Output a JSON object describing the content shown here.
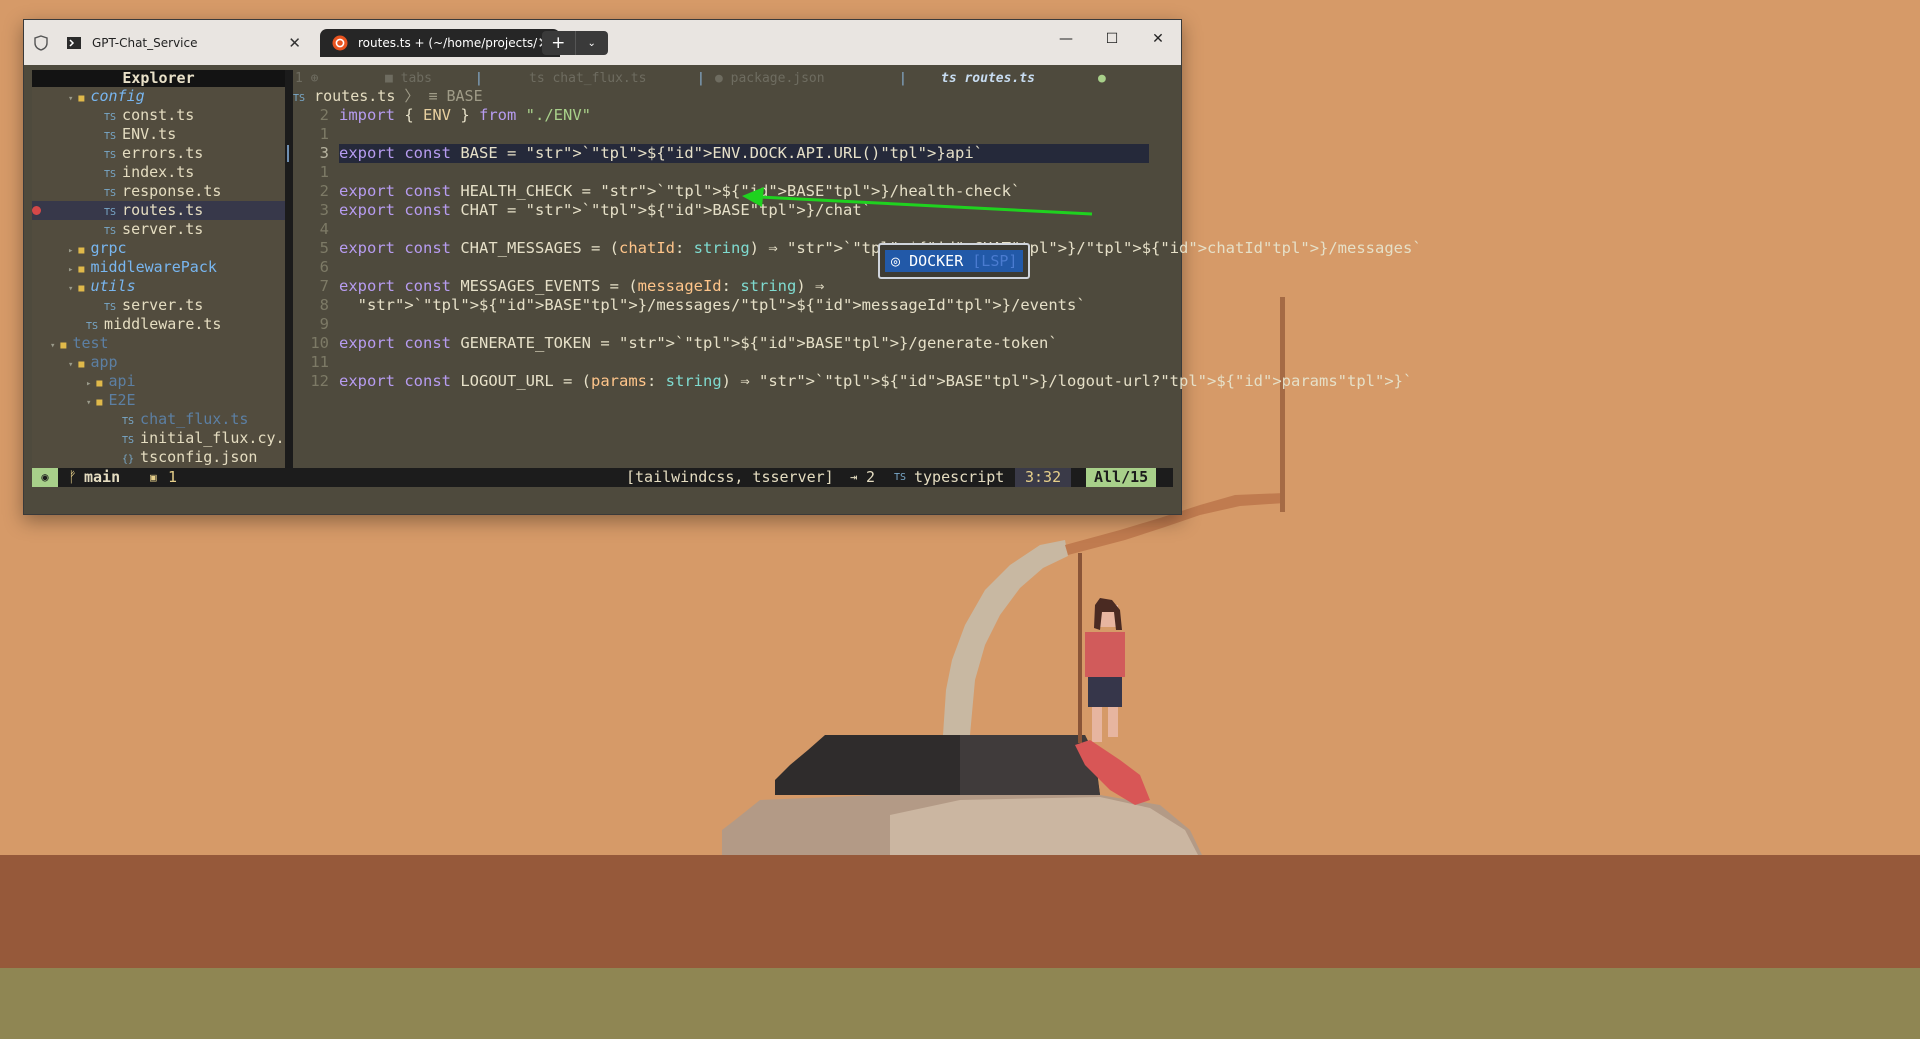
{
  "tabs": [
    {
      "title": "GPT-Chat_Service",
      "icon": "powershell-icon"
    },
    {
      "title": "routes.ts + (~/home/projects/",
      "icon": "ubuntu-icon",
      "active": true
    }
  ],
  "window_controls": {
    "minimize": "—",
    "maximize": "☐",
    "close": "✕",
    "new_tab": "+",
    "dropdown": "⌄"
  },
  "explorer": {
    "title": "Explorer",
    "items": [
      {
        "label": "config",
        "kind": "folder",
        "italic": true,
        "dim": false,
        "indent": 2,
        "expanded": true
      },
      {
        "label": "const.ts",
        "kind": "file",
        "indent": 4
      },
      {
        "label": "ENV.ts",
        "kind": "file",
        "indent": 4
      },
      {
        "label": "errors.ts",
        "kind": "file",
        "indent": 4
      },
      {
        "label": "index.ts",
        "kind": "file",
        "indent": 4
      },
      {
        "label": "response.ts",
        "kind": "file",
        "indent": 4
      },
      {
        "label": "routes.ts",
        "kind": "file",
        "indent": 4,
        "selected": true,
        "error": true
      },
      {
        "label": "server.ts",
        "kind": "file",
        "indent": 4
      },
      {
        "label": "grpc",
        "kind": "folder",
        "indent": 2,
        "expanded": false
      },
      {
        "label": "middlewarePack",
        "kind": "folder",
        "indent": 2,
        "expanded": false
      },
      {
        "label": "utils",
        "kind": "folder",
        "italic": true,
        "indent": 2,
        "expanded": true
      },
      {
        "label": "server.ts",
        "kind": "file",
        "indent": 4
      },
      {
        "label": "middleware.ts",
        "kind": "file",
        "indent": 3
      },
      {
        "label": "test",
        "kind": "folder",
        "dim": true,
        "indent": 1,
        "expanded": true
      },
      {
        "label": "app",
        "kind": "folder",
        "dim": true,
        "indent": 2,
        "expanded": true
      },
      {
        "label": "api",
        "kind": "folder",
        "dim": true,
        "indent": 3,
        "expanded": false
      },
      {
        "label": "E2E",
        "kind": "folder",
        "dim": true,
        "indent": 3,
        "expanded": true
      },
      {
        "label": "chat_flux.ts",
        "kind": "file",
        "dim": true,
        "indent": 5
      },
      {
        "label": "initial_flux.cy.",
        "kind": "file",
        "indent": 5
      },
      {
        "label": "tsconfig.json",
        "kind": "json",
        "indent": 5
      }
    ]
  },
  "bufferline": [
    {
      "label": "1 ⊕"
    },
    {
      "label": "■ tabs"
    },
    {
      "label": "ts chat_flux.ts"
    },
    {
      "label": "● package.json"
    },
    {
      "label": "ts routes.ts",
      "current": true
    },
    {
      "label": "●"
    }
  ],
  "breadcrumb": {
    "file": "routes.ts",
    "symbol": "BASE",
    "icon": "ts-icon"
  },
  "code": {
    "lines": [
      {
        "n": "2",
        "text": "import { ENV } from \"./ENV\""
      },
      {
        "n": "1",
        "text": ""
      },
      {
        "n": "3",
        "text": "export const BASE = `${ENV.DOCK.API.URL()}api`",
        "current": true
      },
      {
        "n": "1",
        "text": ""
      },
      {
        "n": "2",
        "text": "export const HEALTH_CHECK = `${BASE}/health-check`"
      },
      {
        "n": "3",
        "text": "export const CHAT = `${BASE}/chat`"
      },
      {
        "n": "4",
        "text": ""
      },
      {
        "n": "5",
        "text": "export const CHAT_MESSAGES = (chatId: string) ⇒ `${CHAT}/${chatId}/messages`"
      },
      {
        "n": "6",
        "text": ""
      },
      {
        "n": "7",
        "text": "export const MESSAGES_EVENTS = (messageId: string) ⇒"
      },
      {
        "n": "8",
        "text": "  `${BASE}/messages/${messageId}/events`"
      },
      {
        "n": "9",
        "text": ""
      },
      {
        "n": "10",
        "text": "export const GENERATE_TOKEN = `${BASE}/generate-token`"
      },
      {
        "n": "11",
        "text": ""
      },
      {
        "n": "12",
        "text": "export const LOGOUT_URL = (params: string) ⇒ `${BASE}/logout-url?${params}`"
      }
    ]
  },
  "completion": {
    "item": "DOCKER",
    "source": "[LSP]",
    "icon": "◎"
  },
  "annotation": {
    "color": "#1fd21f"
  },
  "statusline": {
    "mode_icon": "◉",
    "branch": "main",
    "diagnostics": "1",
    "lsp": "[tailwindcss, tsserver]",
    "indent": "2",
    "filetype": "typescript",
    "position": "3:32",
    "progress": "All/15"
  },
  "colors": {
    "accent_green": "#a8d08a",
    "selection": "#2259a8",
    "background": "#4e4a3d"
  }
}
